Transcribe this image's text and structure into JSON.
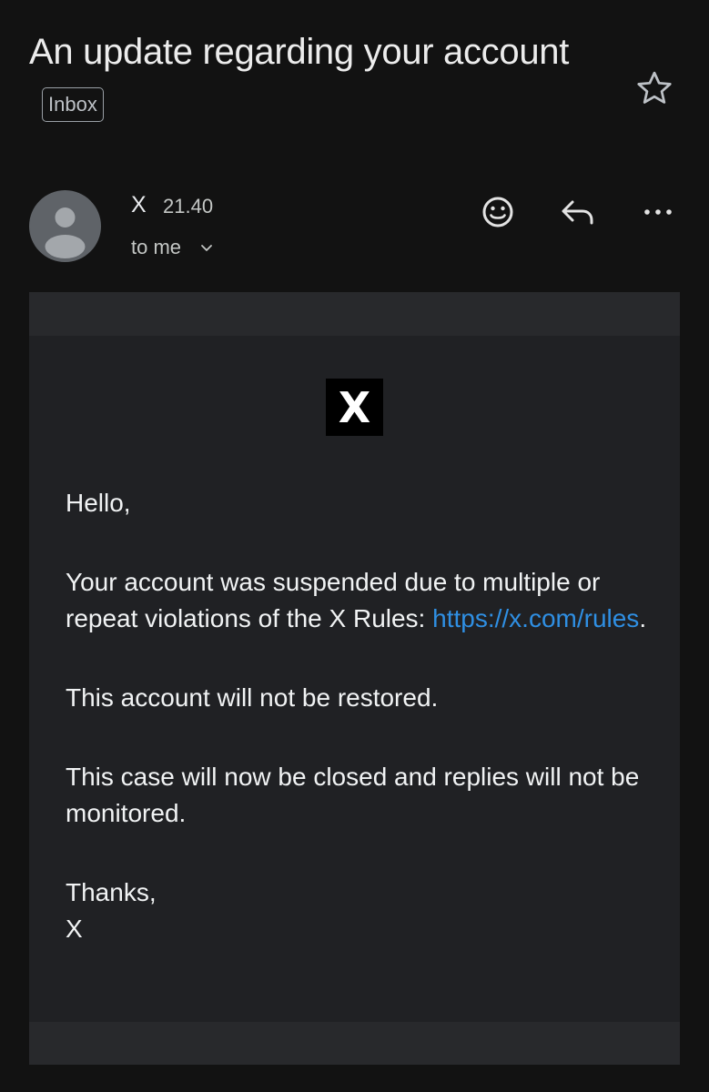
{
  "email": {
    "subject": "An update regarding your account",
    "label": "Inbox",
    "sender": "X",
    "time": "21.40",
    "recipient": "to me"
  },
  "icons": {
    "star": "star-icon",
    "avatar": "person-icon",
    "chevron": "chevron-down-icon",
    "emoji": "emoji-reaction-icon",
    "reply": "reply-icon",
    "more": "more-horizontal-icon",
    "logo": "x-logo"
  },
  "message": {
    "logo_text": "X",
    "greeting": "Hello,",
    "p1_text": "Your account was suspended due to multiple or repeat violations of the X Rules: ",
    "p1_link": "https://x.com/rules",
    "p1_end": ".",
    "p2": "This account will not be restored.",
    "p3": "This case will now be closed and replies will not be monitored.",
    "signoff": "Thanks,",
    "signature": "X"
  },
  "colors": {
    "background": "#121212",
    "card_outer": "#28292c",
    "card_inner": "#202124",
    "link": "#2f8fe3"
  }
}
